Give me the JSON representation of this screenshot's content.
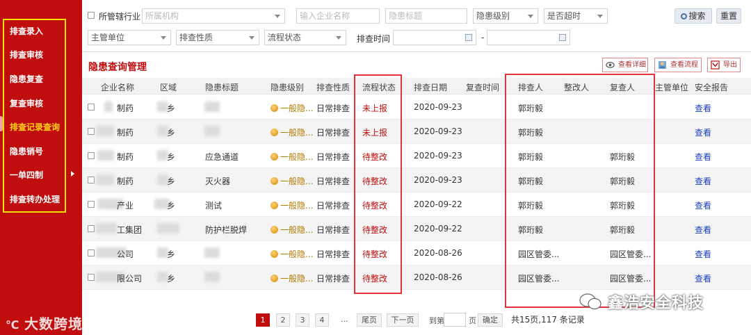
{
  "sidebar": {
    "items": [
      {
        "label": "排查录入"
      },
      {
        "label": "排查审核"
      },
      {
        "label": "隐患复查"
      },
      {
        "label": "复查审核"
      },
      {
        "label": "排查记录查询"
      },
      {
        "label": "隐患销号"
      },
      {
        "label": "一单四制"
      },
      {
        "label": "排查转办处理"
      }
    ],
    "active_index": 4,
    "watermark": "大数跨境"
  },
  "filters": {
    "industry_label": "所管辖行业",
    "org_placeholder": "所属机构",
    "company_placeholder": "输入企业名称",
    "title_placeholder": "隐患标题",
    "level_select": "隐患级别",
    "overdue_select": "是否超时",
    "search_button": "搜索",
    "reset_button": "重置",
    "unit_select": "主管单位",
    "nature_select": "排查性质",
    "status_select": "流程状态",
    "time_label": "排查时间",
    "date_separator": "-"
  },
  "main": {
    "title": "隐患查询管理",
    "actions": {
      "view_detail": "查看详细",
      "view_flow": "查看流程",
      "export": "导出"
    }
  },
  "table": {
    "headers": [
      "企业名称",
      "区域",
      "隐患标题",
      "隐患级别",
      "排查性质",
      "流程状态",
      "排查日期",
      "复查时间",
      "排查人",
      "整改人",
      "复查人",
      "主管单位",
      "安全报告"
    ],
    "rows": [
      {
        "company": "制药",
        "region": "乡",
        "title": "",
        "level": "一般隐...",
        "nature": "日常排查",
        "status": "未上报",
        "date": "2020-09-23",
        "review_time": "",
        "inspector": "郭珩毅",
        "rectifier": "",
        "reviewer": "",
        "unit": "",
        "report": "查看"
      },
      {
        "company": "制药",
        "region": "乡",
        "title": "",
        "level": "一般隐...",
        "nature": "日常排查",
        "status": "未上报",
        "date": "2020-09-23",
        "review_time": "",
        "inspector": "郭珩毅",
        "rectifier": "",
        "reviewer": "",
        "unit": "",
        "report": "查看"
      },
      {
        "company": "制药",
        "region": "乡",
        "title": "应急通道",
        "level": "一般隐...",
        "nature": "日常排查",
        "status": "待整改",
        "date": "2020-09-23",
        "review_time": "",
        "inspector": "郭珩毅",
        "rectifier": "",
        "reviewer": "郭珩毅",
        "unit": "",
        "report": "查看"
      },
      {
        "company": "制药",
        "region": "乡",
        "title": "灭火器",
        "level": "一般隐...",
        "nature": "日常排查",
        "status": "待整改",
        "date": "2020-09-23",
        "review_time": "",
        "inspector": "郭珩毅",
        "rectifier": "",
        "reviewer": "郭珩毅",
        "unit": "",
        "report": "查看"
      },
      {
        "company": "产业",
        "region": "乡",
        "title": "测试",
        "level": "一般隐...",
        "nature": "日常排查",
        "status": "待整改",
        "date": "2020-09-22",
        "review_time": "",
        "inspector": "郭珩毅",
        "rectifier": "",
        "reviewer": "郭珩毅",
        "unit": "",
        "report": "查看"
      },
      {
        "company": "工集团",
        "region": "",
        "title": "防护栏脱焊",
        "level": "一般隐...",
        "nature": "日常排查",
        "status": "待整改",
        "date": "2020-09-22",
        "review_time": "",
        "inspector": "郭珩毅",
        "rectifier": "",
        "reviewer": "郭珩毅",
        "unit": "",
        "report": "查看"
      },
      {
        "company": "公司",
        "region": "乡",
        "title": "",
        "level": "一般隐...",
        "nature": "日常排查",
        "status": "待整改",
        "date": "2020-08-26",
        "review_time": "",
        "inspector": "园区管委...",
        "rectifier": "",
        "reviewer": "园区管委...",
        "unit": "",
        "report": "查看"
      },
      {
        "company": "限公司",
        "region": "乡",
        "title": "",
        "level": "一般隐...",
        "nature": "日常排查",
        "status": "待整改",
        "date": "2020-08-26",
        "review_time": "",
        "inspector": "园区管委...",
        "rectifier": "",
        "reviewer": "园区管委...",
        "unit": "",
        "report": "查看"
      }
    ]
  },
  "pagination": {
    "pages": [
      "1",
      "2",
      "3",
      "4"
    ],
    "ellipsis": "...",
    "last": "尾页",
    "next": "下一页",
    "goto_label": "到第",
    "page_unit": "页",
    "confirm": "确定",
    "summary": "共15页,117 条记录",
    "current": 1
  },
  "brand_watermark": "鑫浩安全科技",
  "colors": {
    "brand_red": "#c00e0e",
    "sidebar_highlight": "#ffd21a",
    "annotation_yellow": "#f6e200",
    "annotation_red": "#e0343a",
    "link_blue": "#1a3fbf"
  }
}
